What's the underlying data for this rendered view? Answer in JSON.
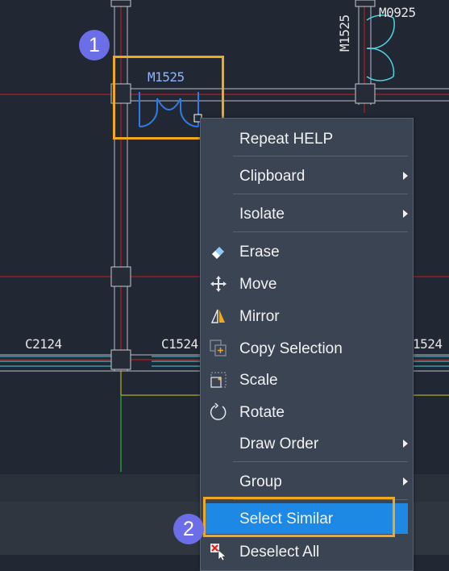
{
  "drawing": {
    "labels": {
      "door_m1525": "M1525",
      "door_m0925": "M0925",
      "door_m1525_vertical": "M1525",
      "window_c2124": "C2124",
      "window_c1524": "C1524",
      "window_c1524_right": "1524"
    }
  },
  "markers": {
    "step1": "1",
    "step2": "2"
  },
  "context_menu": {
    "repeat_help": "Repeat HELP",
    "clipboard": "Clipboard",
    "isolate": "Isolate",
    "erase": "Erase",
    "move": "Move",
    "mirror": "Mirror",
    "copy_selection": "Copy Selection",
    "scale": "Scale",
    "rotate": "Rotate",
    "draw_order": "Draw Order",
    "group": "Group",
    "select_similar": "Select Similar",
    "deselect_all": "Deselect All"
  },
  "colors": {
    "background": "#222833",
    "menu_background": "#3b4453",
    "menu_highlight": "#1e88e5",
    "selection_outline": "#f0a820",
    "marker": "#6b6ee6",
    "axis_red": "#c81e1e",
    "door_blue": "#2e7be6",
    "window_cyan": "#4fd2e0"
  }
}
